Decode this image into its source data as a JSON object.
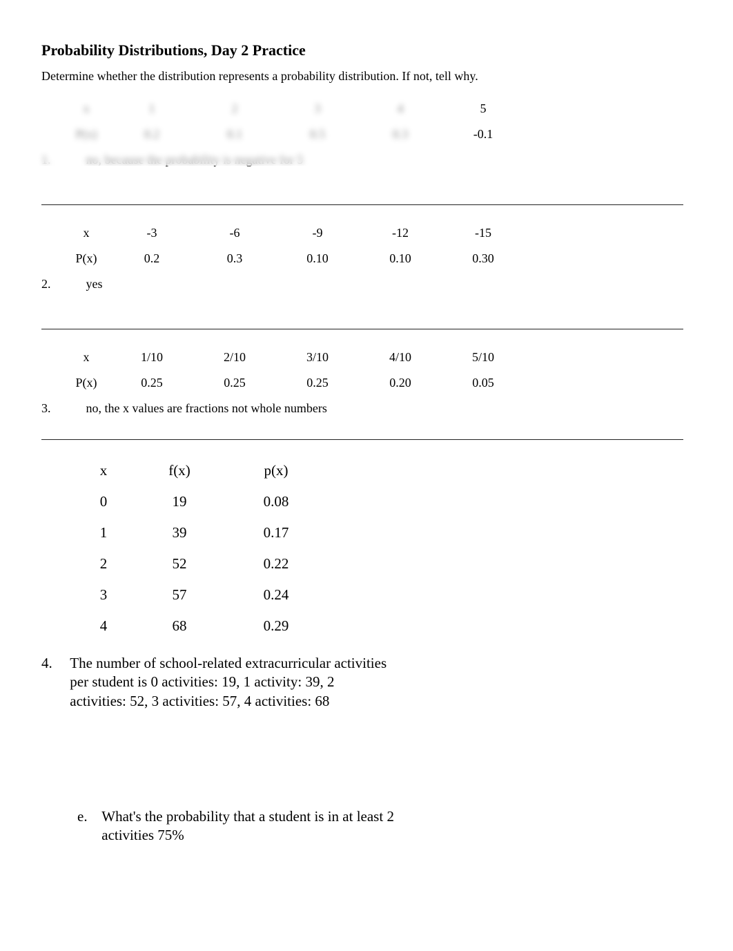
{
  "title": "Probability Distributions, Day 2 Practice",
  "instruction": "Determine whether the distribution represents a probability distribution. If not, tell why.",
  "q1": {
    "number": "1.",
    "rowLabelX": "x",
    "rowLabelP": "P(x)",
    "x": [
      "1",
      "2",
      "3",
      "4",
      "5"
    ],
    "p": [
      "0.2",
      "0.1",
      "0.5",
      "0.3",
      "-0.1"
    ],
    "answer": "no, because the probability is negative for 5"
  },
  "q2": {
    "number": "2.",
    "rowLabelX": "x",
    "rowLabelP": "P(x)",
    "x": [
      "-3",
      "-6",
      "-9",
      "-12",
      "-15"
    ],
    "p": [
      "0.2",
      "0.3",
      "0.10",
      "0.10",
      "0.30"
    ],
    "answer": "yes"
  },
  "q3": {
    "number": "3.",
    "rowLabelX": "x",
    "rowLabelP": "P(x)",
    "x": [
      "1/10",
      "2/10",
      "3/10",
      "4/10",
      "5/10"
    ],
    "p": [
      "0.25",
      "0.25",
      "0.25",
      "0.20",
      "0.05"
    ],
    "answer": "no, the x values are fractions not whole numbers"
  },
  "q4": {
    "number": "4.",
    "headers": {
      "x": "x",
      "f": "f(x)",
      "p": "p(x)"
    },
    "rows": [
      {
        "x": "0",
        "f": "19",
        "p": "0.08"
      },
      {
        "x": "1",
        "f": "39",
        "p": "0.17"
      },
      {
        "x": "2",
        "f": "52",
        "p": "0.22"
      },
      {
        "x": "3",
        "f": "57",
        "p": "0.24"
      },
      {
        "x": "4",
        "f": "68",
        "p": "0.29"
      }
    ],
    "prompt": "The number of school-related extracurricular activities per student is 0 activities: 19, 1 activity: 39, 2 activities: 52, 3 activities: 57, 4 activities: 68",
    "sub_e": {
      "letter": "e.",
      "text": "What's the probability that a student is in at least 2 activities 75%"
    }
  }
}
